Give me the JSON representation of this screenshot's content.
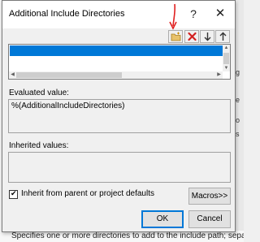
{
  "background": {
    "edge_fragments": [
      "g",
      "e",
      "o",
      "s"
    ],
    "status_text": "Specifies one or more directories to add to the include path; separate with"
  },
  "dialog": {
    "title": "Additional Include Directories",
    "help_label": "?",
    "close_label": "✕",
    "toolbar": {
      "new_line": "new-folder-icon",
      "delete": "delete-icon",
      "move_down": "arrow-down-icon",
      "move_up": "arrow-up-icon"
    },
    "annotation_color": "#e02020",
    "list": {
      "selected_color": "#0078d7",
      "scroll_up": "▲",
      "scroll_down": "▼",
      "scroll_left": "◀",
      "scroll_right": "▶"
    },
    "evaluated": {
      "label": "Evaluated value:",
      "value": "%(AdditionalIncludeDirectories)"
    },
    "inherited": {
      "label": "Inherited values:",
      "value": ""
    },
    "inherit_checkbox": {
      "label": "Inherit from parent or project defaults",
      "checked": true,
      "check_mark": "✔"
    },
    "buttons": {
      "macros": "Macros>>",
      "ok": "OK",
      "cancel": "Cancel"
    }
  }
}
